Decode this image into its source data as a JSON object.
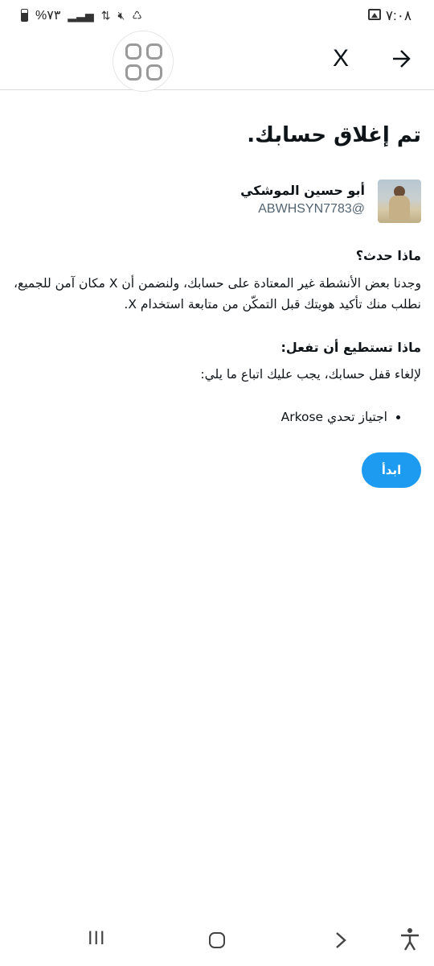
{
  "status_bar": {
    "time": "٧:٠٨",
    "battery": "%٧٣"
  },
  "header": {
    "close_label": "X"
  },
  "main": {
    "title": "تم إغلاق حسابك.",
    "user": {
      "name": "أبو حسين الموشكي",
      "handle": "@ABWHSYN7783"
    },
    "what_happened": {
      "heading": "ماذا حدث؟",
      "body": "وجدنا بعض الأنشطة غير المعتادة على حسابك، ولنضمن أن X مكان آمن للجميع، نطلب منك تأكيد هويتك قبل التمكّن من متابعة استخدام X."
    },
    "what_you_can_do": {
      "heading": "ماذا تستطيع أن تفعل:",
      "body": "لإلغاء قفل حسابك، يجب عليك اتباع ما يلي:",
      "steps": [
        "اجتياز تحدي Arkose"
      ]
    },
    "start_button": "ابدأ"
  },
  "nav_bar": {
    "recents_glyph": "III"
  }
}
